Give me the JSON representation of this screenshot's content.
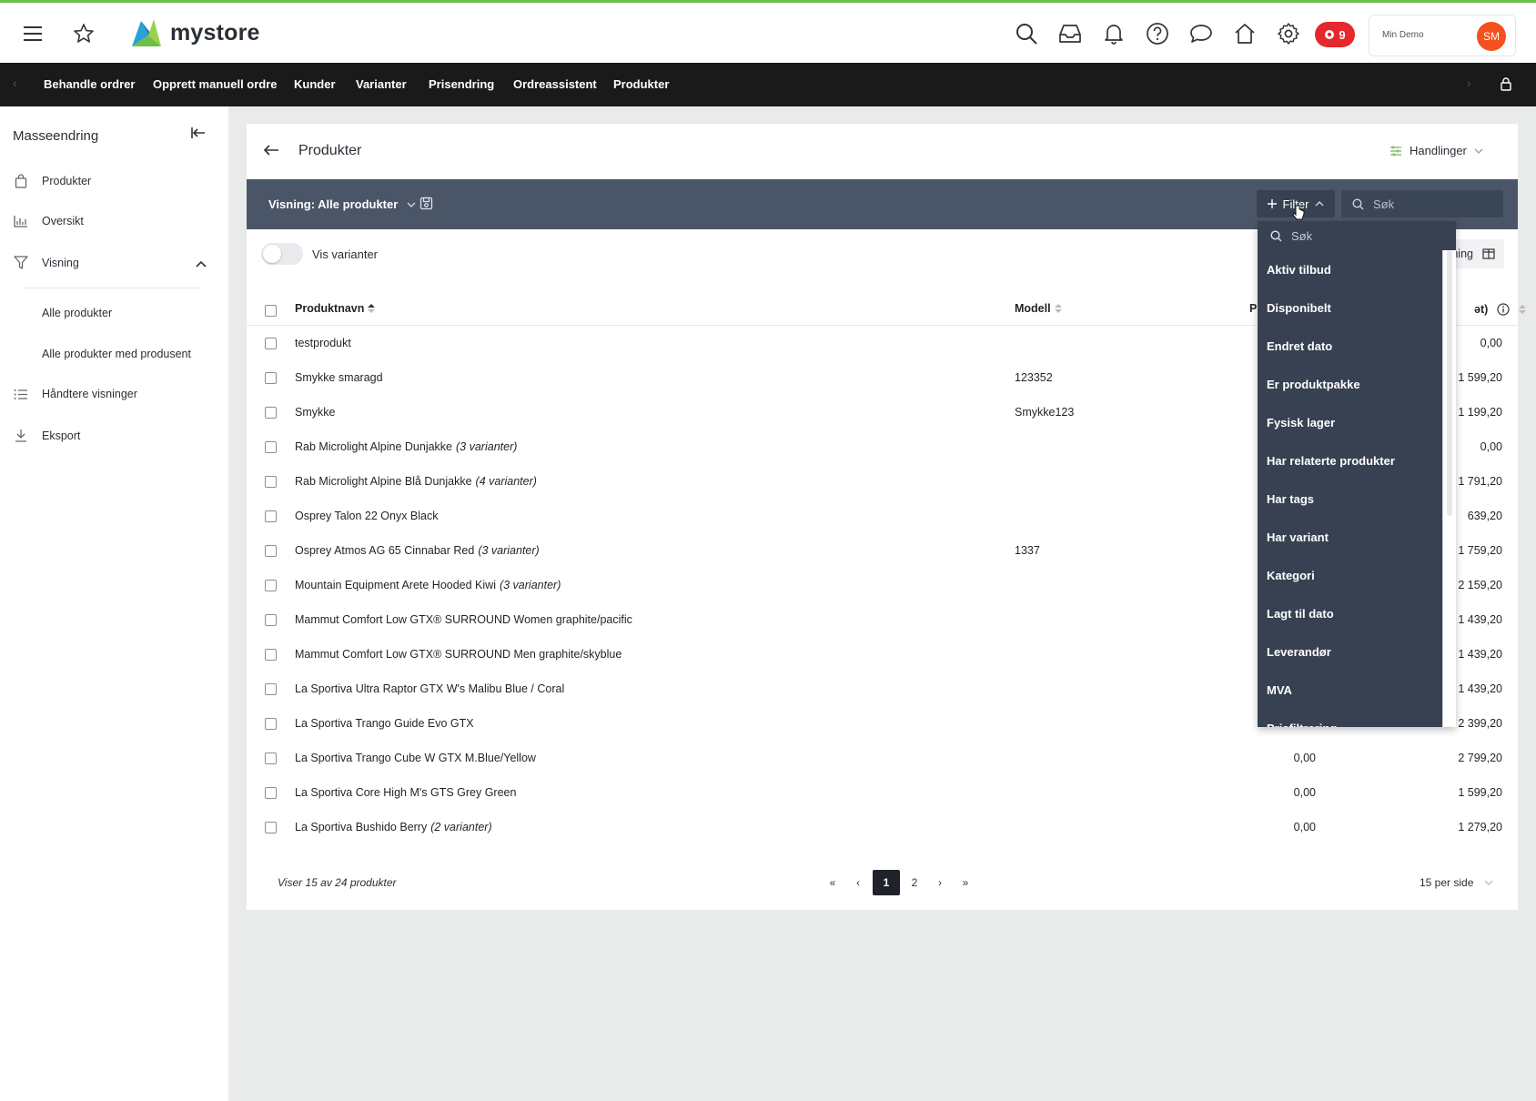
{
  "brand": {
    "name": "mystore"
  },
  "notifications_badge": "9",
  "account": {
    "store_name": "Min Demo",
    "initials": "SM"
  },
  "colors": {
    "accent_green": "#6cc04a",
    "badge_red": "#e5282c",
    "avatar_orange": "#f4511e",
    "viewbar": "#4a5568"
  },
  "header_icons": [
    "menu-icon",
    "star-icon",
    "search-icon",
    "inbox-icon",
    "bell-icon",
    "help-icon",
    "chat-icon",
    "home-icon",
    "gear-icon"
  ],
  "nav": {
    "items": [
      "Behandle ordrer",
      "Opprett manuell ordre",
      "Kunder",
      "Varianter",
      "Prisendring",
      "Ordreassistent",
      "Produkter"
    ]
  },
  "sidebar": {
    "title": "Masseendring",
    "items": [
      "Produkter",
      "Oversikt",
      "Visning",
      "Håndtere visninger",
      "Eksport"
    ],
    "sub_items": [
      "Alle produkter",
      "Alle produkter med produsent"
    ]
  },
  "page": {
    "title": "Produkter",
    "actions_label": "Handlinger",
    "view_label": "Visning: Alle produkter",
    "filter_label": "Filter",
    "search_placeholder": "Søk",
    "show_variants_label": "Vis varianter",
    "columns_label": "ning"
  },
  "table": {
    "headers": {
      "name": "Produktnavn",
      "model": "Modell",
      "price_partial": "P",
      "last_partial": "ət)"
    },
    "rows": [
      {
        "name": "testprodukt",
        "variants": "",
        "model": "",
        "col3": "",
        "last": "0,00"
      },
      {
        "name": "Smykke smaragd",
        "variants": "",
        "model": "123352",
        "col3": "",
        "last": "1 599,20"
      },
      {
        "name": "Smykke",
        "variants": "",
        "model": "Smykke123",
        "col3": "",
        "last": "1 199,20"
      },
      {
        "name": "Rab Microlight Alpine Dunjakke",
        "variants": "(3 varianter)",
        "model": "",
        "col3": "",
        "last": "0,00"
      },
      {
        "name": "Rab Microlight Alpine Blå Dunjakke",
        "variants": "(4 varianter)",
        "model": "",
        "col3": "",
        "last": "1 791,20"
      },
      {
        "name": "Osprey Talon 22 Onyx Black",
        "variants": "",
        "model": "",
        "col3": "",
        "last": "639,20"
      },
      {
        "name": "Osprey Atmos AG 65 Cinnabar Red",
        "variants": "(3 varianter)",
        "model": "1337",
        "col3": "",
        "last": "1 759,20"
      },
      {
        "name": "Mountain Equipment Arete Hooded Kiwi",
        "variants": "(3 varianter)",
        "model": "",
        "col3": "",
        "last": "2 159,20"
      },
      {
        "name": "Mammut Comfort Low GTX® SURROUND Women graphite/pacific",
        "variants": "",
        "model": "",
        "col3": "",
        "last": "1 439,20"
      },
      {
        "name": "Mammut Comfort Low GTX® SURROUND Men graphite/skyblue",
        "variants": "",
        "model": "",
        "col3": "",
        "last": "1 439,20"
      },
      {
        "name": "La Sportiva Ultra Raptor GTX W's Malibu Blue / Coral",
        "variants": "",
        "model": "",
        "col3": "",
        "last": "1 439,20"
      },
      {
        "name": "La Sportiva Trango Guide Evo GTX",
        "variants": "",
        "model": "",
        "col3": "",
        "last": "2 399,20"
      },
      {
        "name": "La Sportiva Trango Cube W GTX M.Blue/Yellow",
        "variants": "",
        "model": "",
        "col3": "0,00",
        "last": "2 799,20"
      },
      {
        "name": "La Sportiva Core High M's GTS Grey Green",
        "variants": "",
        "model": "",
        "col3": "0,00",
        "last": "1 599,20"
      },
      {
        "name": "La Sportiva Bushido Berry",
        "variants": "(2 varianter)",
        "model": "",
        "col3": "0,00",
        "last": "1 279,20"
      }
    ]
  },
  "footer": {
    "info": "Viser 15 av 24 produkter",
    "pages": [
      "«",
      "‹",
      "1",
      "2",
      "›",
      "»"
    ],
    "current_page": "1",
    "per_page": "15 per side"
  },
  "filter_dropdown": {
    "search_placeholder": "Søk",
    "options": [
      "Aktiv tilbud",
      "Disponibelt",
      "Endret dato",
      "Er produktpakke",
      "Fysisk lager",
      "Har relaterte produkter",
      "Har tags",
      "Har variant",
      "Kategori",
      "Lagt til dato",
      "Leverandør",
      "MVA",
      "Prisfiltrering"
    ]
  }
}
